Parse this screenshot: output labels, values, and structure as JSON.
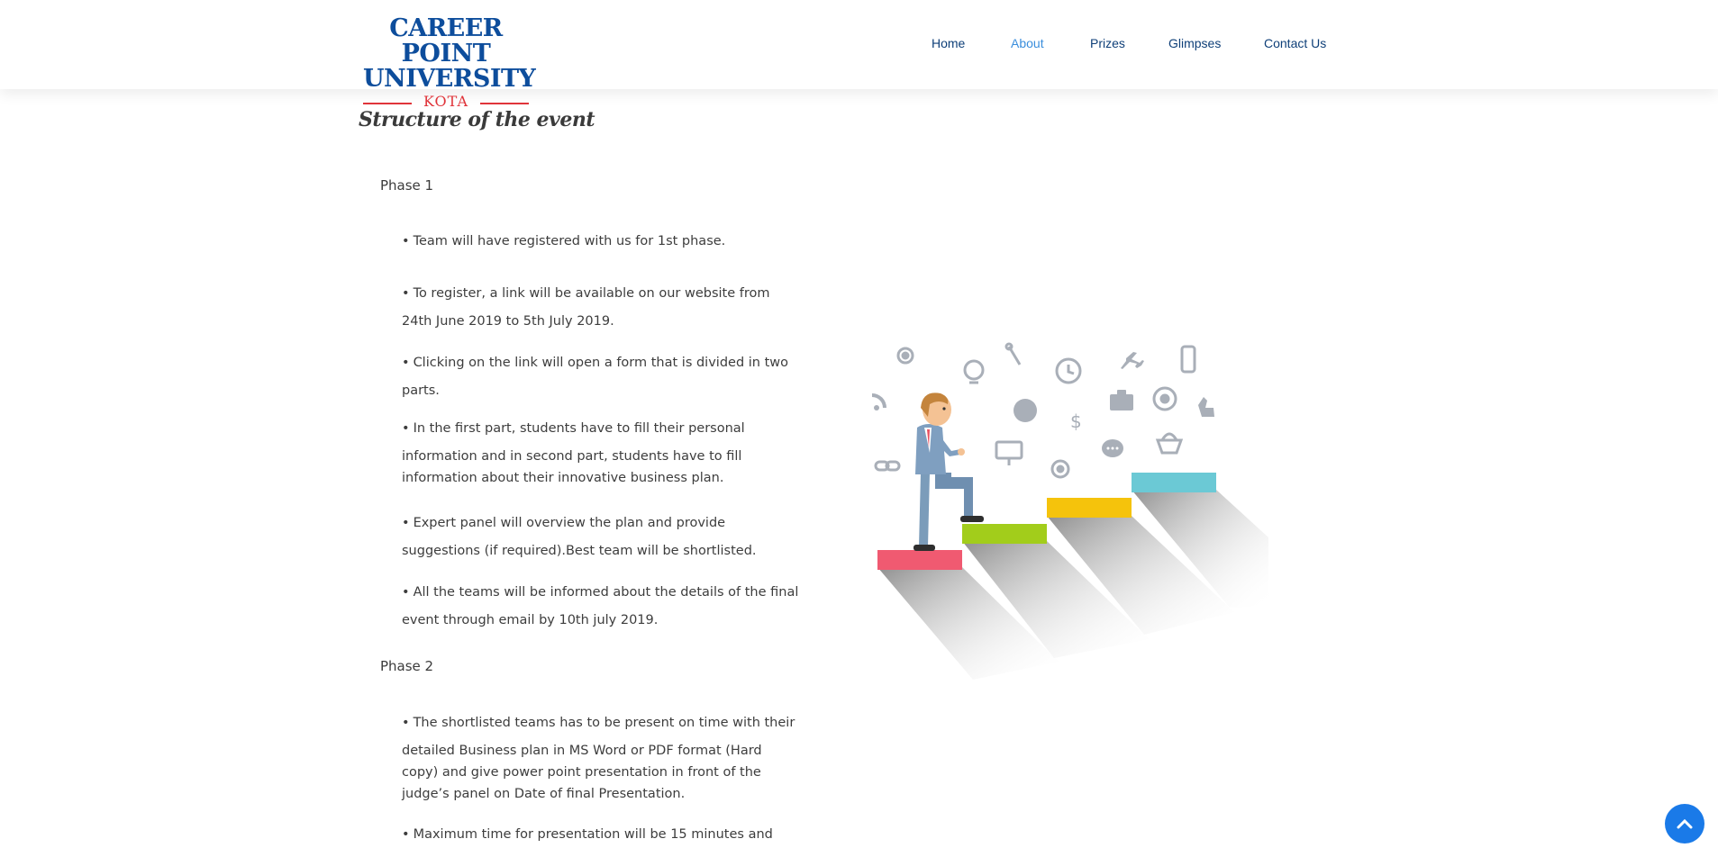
{
  "header": {
    "logo": {
      "line1": "CAREER POINT",
      "line2": "UNIVERSITY",
      "line3": "KOTA"
    },
    "nav": [
      {
        "label": "Home",
        "active": false
      },
      {
        "label": "About",
        "active": true
      },
      {
        "label": "Prizes",
        "active": false
      },
      {
        "label": "Glimpses",
        "active": false
      },
      {
        "label": "Contact Us",
        "active": false
      }
    ]
  },
  "main": {
    "title": "Structure of the event",
    "phase1": {
      "label": "Phase 1",
      "bullets": [
        [
          "Team will have registered with us for 1st phase."
        ],
        [
          "To register, a link will be available on our website from",
          "24th June 2019 to 5th July 2019."
        ],
        [
          "Clicking on the link will open a form that is divided in two",
          "parts."
        ],
        [
          "In the first part, students have to fill their personal",
          "information and in second part, students have to fill",
          "information about their innovative business plan."
        ],
        [
          "Expert panel will overview the plan and provide",
          "suggestions (if required).Best team will be shortlisted."
        ],
        [
          "All the teams will be informed about the details of the final",
          "event through email by 10th july 2019."
        ]
      ]
    },
    "phase2": {
      "label": "Phase 2",
      "bullets": [
        [
          "The shortlisted teams has to be present on time with their",
          "detailed Business plan in MS Word or PDF format (Hard",
          "copy) and give power point presentation in front of the",
          "judge’s panel on Date of final Presentation."
        ],
        [
          "Maximum time for presentation will be 15 minutes and"
        ]
      ]
    }
  },
  "illustration": {
    "icons": [
      "gear-icon",
      "lightbulb-icon",
      "wrench-icon",
      "clock-icon",
      "airplane-icon",
      "phone-icon",
      "rss-icon",
      "briefcase-icon",
      "gear-icon",
      "thumbs-up-icon",
      "globe-icon",
      "dollar-icon",
      "monitor-icon",
      "chat-icon",
      "basket-icon",
      "link-icon",
      "gear-icon"
    ],
    "step_colors": [
      "#f05a71",
      "#a2cd1b",
      "#f5c30c",
      "#6bc9d5"
    ],
    "icon_color": "#a9afb8"
  },
  "colors": {
    "brand_blue": "#0d4d9c",
    "brand_red": "#e0343a",
    "nav_active": "#3a8edc",
    "scroll_button": "#1a7ae8"
  }
}
